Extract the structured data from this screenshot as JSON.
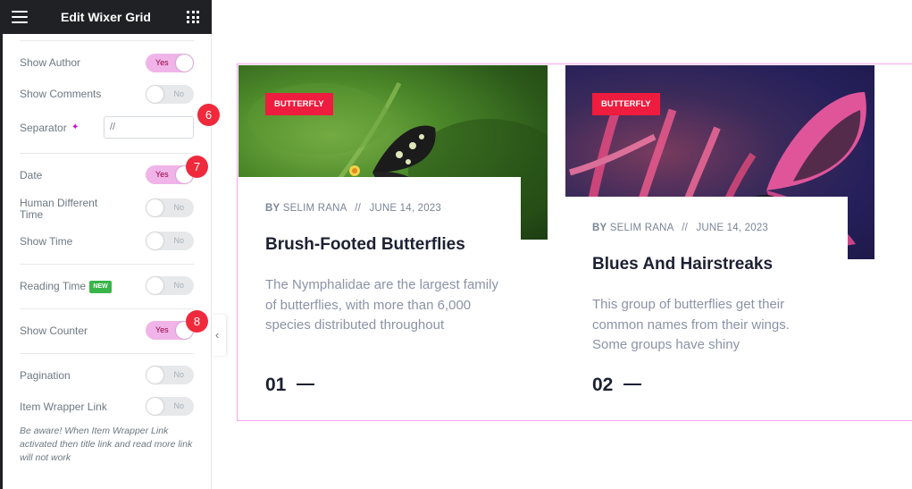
{
  "panel": {
    "title": "Edit Wixer Grid",
    "controls": {
      "show_author": {
        "label": "Show Author",
        "state": "Yes"
      },
      "show_comments": {
        "label": "Show Comments",
        "state": "No"
      },
      "separator": {
        "label": "Separator",
        "value": "//"
      },
      "date": {
        "label": "Date",
        "state": "Yes"
      },
      "human_different_time": {
        "label": "Human Different Time",
        "state": "No"
      },
      "show_time": {
        "label": "Show Time",
        "state": "No"
      },
      "reading_time": {
        "label": "Reading Time",
        "badge": "NEW",
        "state": "No"
      },
      "show_counter": {
        "label": "Show Counter",
        "state": "Yes"
      },
      "pagination": {
        "label": "Pagination",
        "state": "No"
      },
      "item_wrapper_link": {
        "label": "Item Wrapper Link",
        "state": "No"
      }
    },
    "note": "Be aware! When Item Wrapper Link activated then title link and read more link will not work"
  },
  "steps": [
    "6",
    "7",
    "8"
  ],
  "posts": [
    {
      "category": "BUTTERFLY",
      "by": "BY",
      "author": "SELIM RANA",
      "separator": "//",
      "date": "JUNE 14, 2023",
      "title": "Brush-Footed Butterflies",
      "excerpt": "The Nymphalidae are the largest family of butterflies, with more than 6,000 species distributed throughout",
      "counter": "01"
    },
    {
      "category": "BUTTERFLY",
      "by": "BY",
      "author": "SELIM RANA",
      "separator": "//",
      "date": "JUNE 14, 2023",
      "title": "Blues And Hairstreaks",
      "excerpt": "This group of butterflies get their common names from their wings. Some groups have shiny",
      "counter": "02"
    }
  ],
  "colors": {
    "panel_header": "#1f2124",
    "toggle_on": "#f0b4e9",
    "toggle_off": "#e6e8ea",
    "step_badge": "#ee2a3c",
    "category_tag": "#ee1c3e",
    "grid_border": "#f3a7ef",
    "new_badge": "#39b54a"
  }
}
